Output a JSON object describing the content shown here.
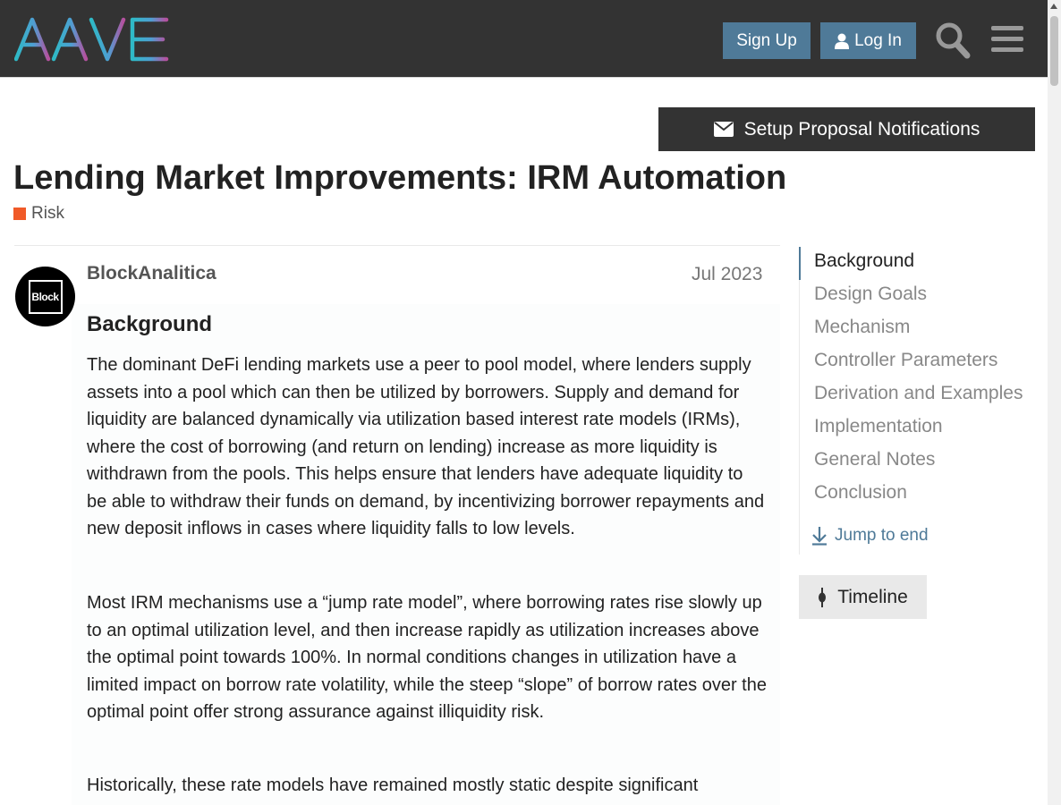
{
  "header": {
    "logo_text": "AAVE",
    "signup_label": "Sign Up",
    "login_label": "Log In",
    "icons": [
      "aave-logo",
      "user-icon",
      "search-icon",
      "hamburger-menu-icon"
    ]
  },
  "notifications": {
    "label": "Setup Proposal Notifications",
    "icon": "envelope-icon"
  },
  "topic": {
    "title": "Lending Market Improvements: IRM Automation",
    "category": "Risk",
    "category_color": "#f05a28"
  },
  "post": {
    "author": "BlockAnalitica",
    "avatar_text": "Block",
    "date": "Jul 2023",
    "heading": "Background",
    "paragraphs": [
      "The dominant DeFi lending markets use a peer to pool model, where lenders supply assets into a pool which can then be utilized by borrowers. Supply and demand for liquidity are balanced dynamically via utilization based interest rate models (IRMs), where the cost of borrowing (and return on lending) increase as more liquidity is withdrawn from the pools. This helps ensure that lenders have adequate liquidity to be able to withdraw their funds on demand, by incentivizing borrower repayments and new deposit inflows in cases where liquidity falls to low levels.",
      "Most IRM mechanisms use a “jump rate model”, where borrowing rates rise slowly up to an optimal utilization level, and then increase rapidly as utilization increases above the optimal point towards 100%. In normal conditions changes in utilization have a limited impact on borrow rate volatility, while the steep “slope” of borrow rates over the optimal point offer strong assurance against illiquidity risk.",
      "Historically, these rate models have remained mostly static despite significant"
    ]
  },
  "toc": {
    "items": [
      "Background",
      "Design Goals",
      "Mechanism",
      "Controller Parameters",
      "Derivation and Examples",
      "Implementation",
      "General Notes",
      "Conclusion"
    ],
    "jump_label": "Jump to end",
    "timeline_label": "Timeline"
  },
  "colors": {
    "header_bg": "#333333",
    "button_blue": "#4f7a98",
    "accent_orange": "#f05a28"
  }
}
